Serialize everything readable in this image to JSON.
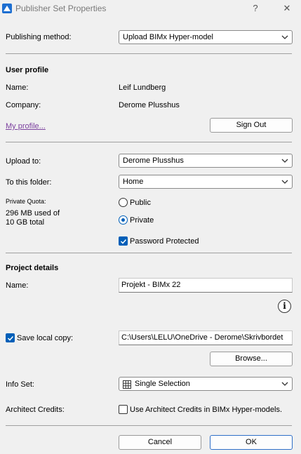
{
  "window": {
    "title": "Publisher Set Properties",
    "help_glyph": "?",
    "close_glyph": "✕"
  },
  "publishing": {
    "label": "Publishing method:",
    "value": "Upload BIMx Hyper-model"
  },
  "user_profile": {
    "heading": "User profile",
    "name_label": "Name:",
    "name_value": "Leif Lundberg",
    "company_label": "Company:",
    "company_value": "Derome Plusshus",
    "my_profile_link": "My profile...",
    "sign_out_label": "Sign Out"
  },
  "upload": {
    "upload_to_label": "Upload to:",
    "upload_to_value": "Derome Plusshus",
    "folder_label": "To this folder:",
    "folder_value": "Home",
    "quota_label": "Private Quota:",
    "quota_line1": "296 MB used of",
    "quota_line2": "10 GB total",
    "public_label": "Public",
    "public_checked": false,
    "private_label": "Private",
    "private_checked": true,
    "password_label": "Password Protected",
    "password_checked": true
  },
  "project": {
    "heading": "Project details",
    "name_label": "Name:",
    "name_value": "Projekt - BIMx 22",
    "info_glyph": "i",
    "save_local_label": "Save local copy:",
    "save_local_checked": true,
    "path_value": "C:\\Users\\LELU\\OneDrive - Derome\\Skrivbordet",
    "browse_label": "Browse...",
    "info_set_label": "Info Set:",
    "info_set_value": "Single Selection",
    "architect_label": "Architect Credits:",
    "architect_checkbox_label": "Use Architect Credits in BIMx Hyper-models.",
    "architect_checked": false
  },
  "footer": {
    "cancel_label": "Cancel",
    "ok_label": "OK"
  },
  "colors": {
    "accent": "#005fb8",
    "link": "#7b3f9e",
    "background": "#f0f0f0"
  }
}
